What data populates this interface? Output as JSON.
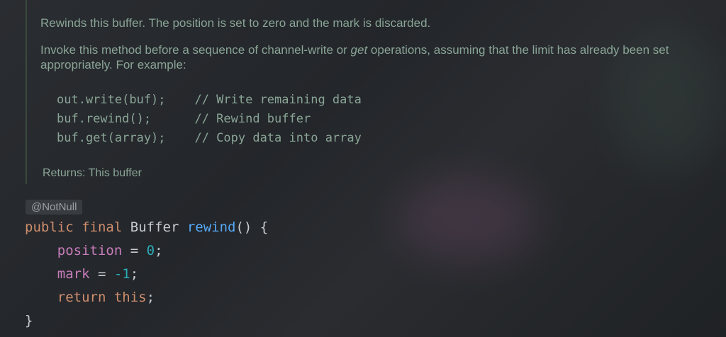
{
  "doc": {
    "line1": "Rewinds this buffer. The position is set to zero and the mark is discarded.",
    "para2_a": "Invoke this method before a sequence of channel-write or ",
    "para2_em": "get",
    "para2_b": " operations, assuming that the limit has already been set appropriately. For example:",
    "code": [
      "out.write(buf);    // Write remaining data",
      "buf.rewind();      // Rewind buffer",
      "buf.get(array);    // Copy data into array"
    ],
    "returns": "Returns: This buffer"
  },
  "annotation": "@NotNull",
  "source": {
    "kw_public": "public",
    "kw_final": "final",
    "type": "Buffer",
    "method": "rewind",
    "sig_tail": "() {",
    "field_position": "position",
    "assign": " = ",
    "zero": "0",
    "semi": ";",
    "field_mark": "mark",
    "neg_one": "-1",
    "kw_return": "return",
    "kw_this": "this",
    "close": "}"
  },
  "colors": {
    "doc_text": "#8aa596",
    "keyword": "#cf8e6d",
    "method": "#56a8f5",
    "field": "#c77dbb",
    "number": "#2aacb8"
  }
}
